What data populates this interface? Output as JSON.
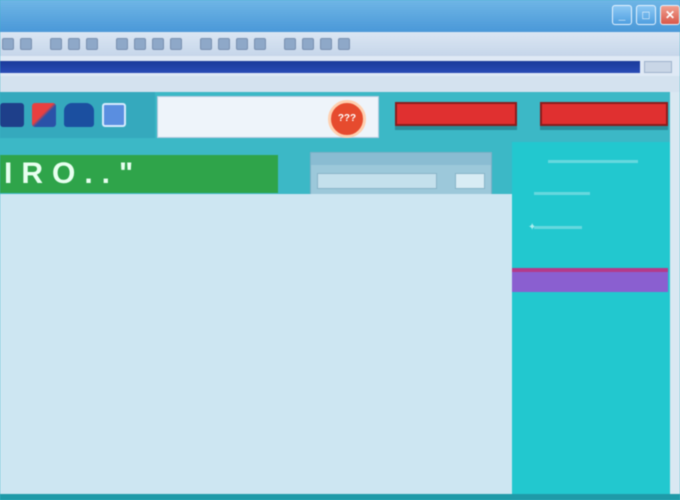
{
  "window": {
    "minimize_label": "_",
    "maximize_label": "□",
    "close_label": "✕"
  },
  "banner": {
    "text": "IRO..\""
  },
  "badge": {
    "text": "???"
  },
  "colors": {
    "accent_red": "#e03030",
    "banner_green": "#2fa44a",
    "sidebar_teal": "#22c8cf",
    "purple_bar": "#8a5fd0"
  },
  "icons": [
    "app-icon-1",
    "app-icon-2",
    "cloud-icon",
    "mail-icon"
  ]
}
